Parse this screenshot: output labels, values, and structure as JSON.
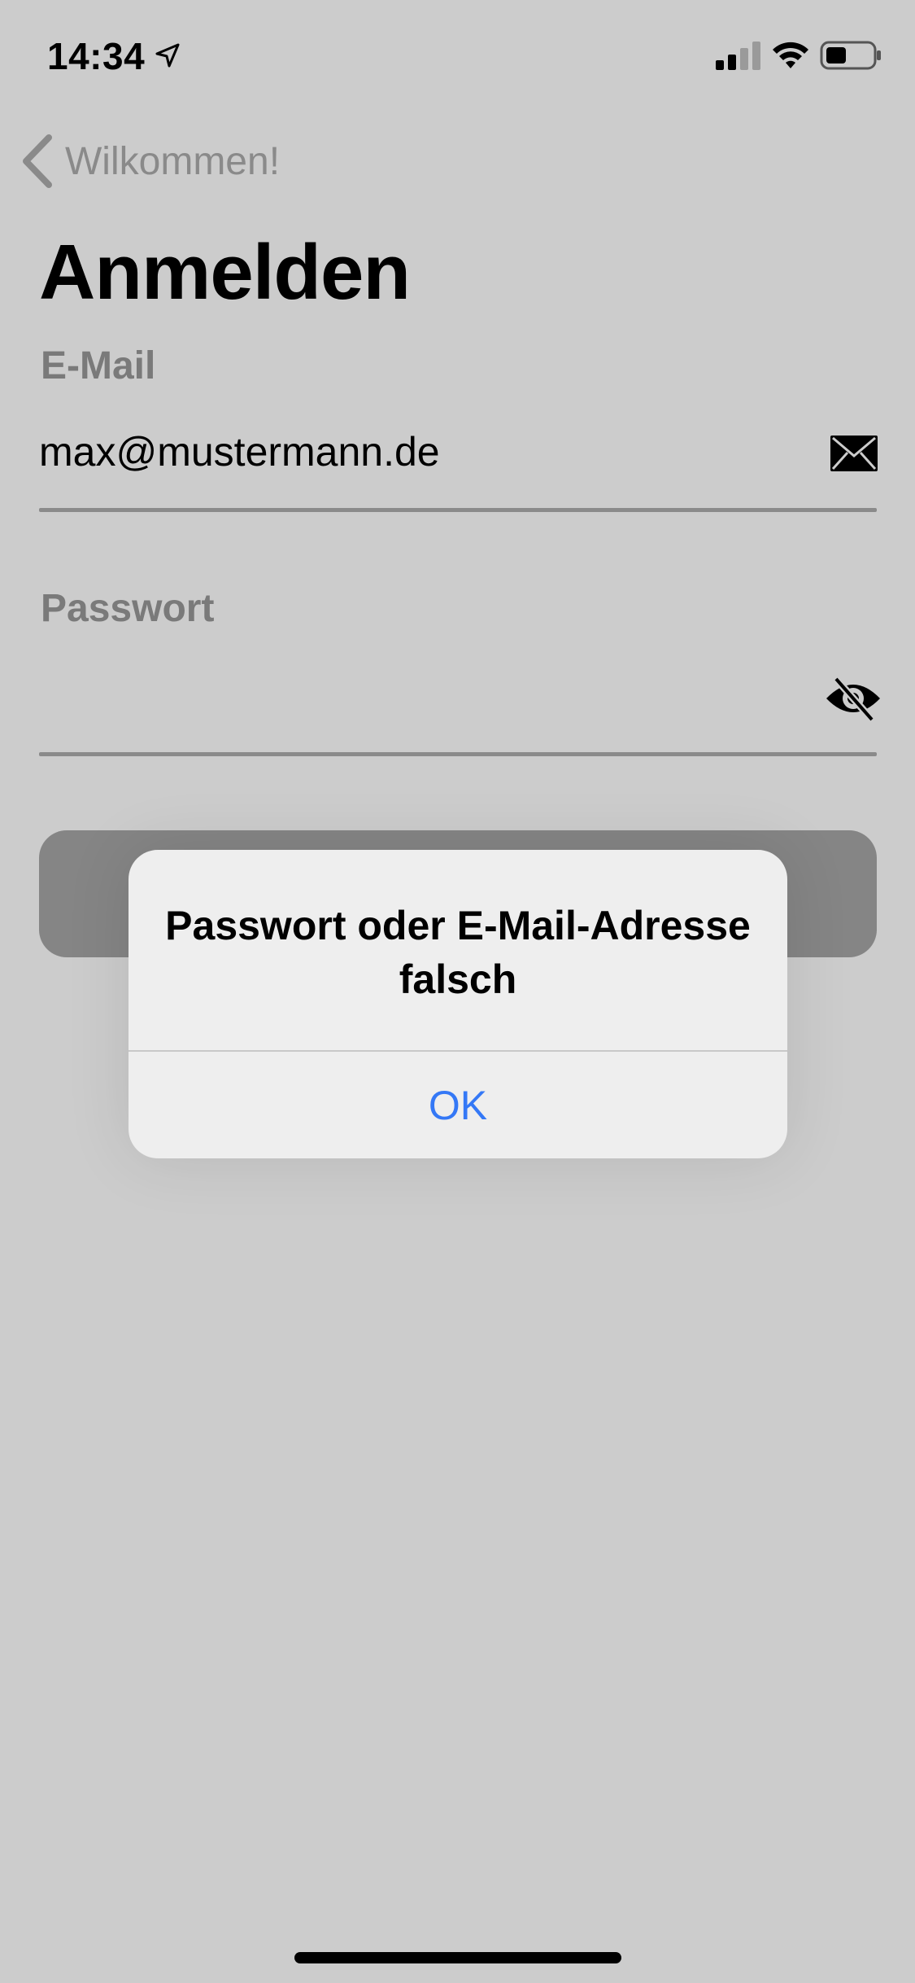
{
  "status_bar": {
    "time": "14:34",
    "icons": [
      "location-icon",
      "signal-icon",
      "wifi-icon",
      "battery-icon"
    ]
  },
  "nav": {
    "back_label": "Wilkommen!",
    "back_icon": "back-chevron-icon"
  },
  "page": {
    "title": "Anmelden"
  },
  "form": {
    "email_label": "E-Mail",
    "email_value": "max@mustermann.de",
    "email_icon": "envelope-icon",
    "password_label": "Passwort",
    "password_value": "",
    "password_icon": "eye-slash-icon"
  },
  "alert": {
    "message": "Passwort oder E-Mail-Adresse falsch",
    "ok_label": "OK"
  },
  "colors": {
    "background": "#cccccc",
    "label_gray": "#7a7a7a",
    "alert_background": "#eeeeee",
    "accent_blue": "#3478f6",
    "button_gray": "#858585"
  }
}
